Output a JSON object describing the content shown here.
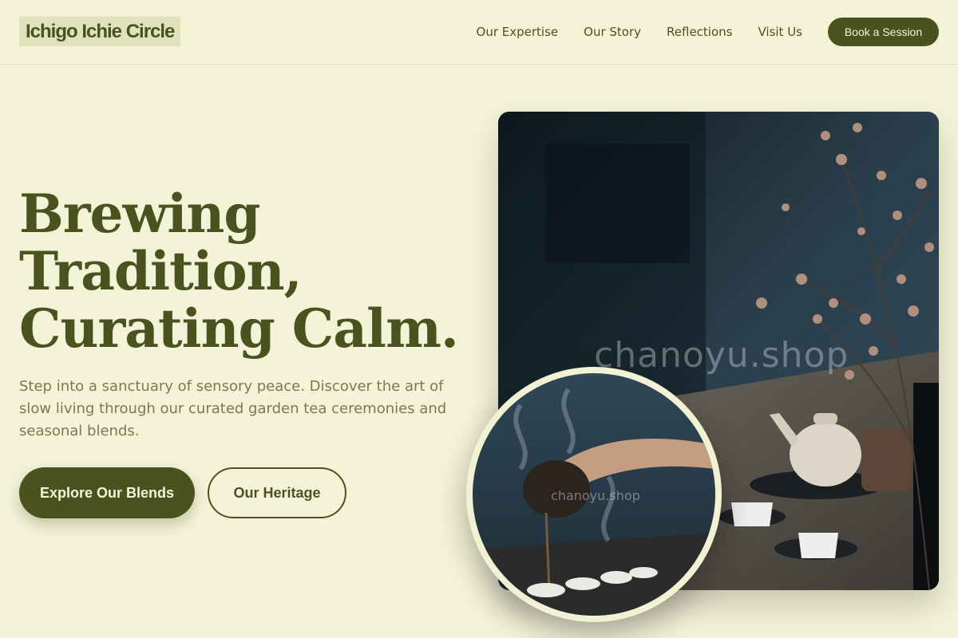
{
  "brand": {
    "name": "Ichigo Ichie Circle"
  },
  "nav": {
    "links": [
      "Our Expertise",
      "Our Story",
      "Reflections",
      "Visit Us"
    ],
    "cta_label": "Book a Session"
  },
  "hero": {
    "title_lines": [
      "Brewing",
      "Tradition,",
      "Curating Calm."
    ],
    "subtitle": "Step into a sanctuary of sensory peace. Discover the art of slow living through our curated garden tea ceremonies and seasonal blends.",
    "primary_button": "Explore Our Blends",
    "secondary_button": "Our Heritage"
  },
  "images": {
    "main_watermark": "chanoyu.shop",
    "circle_watermark": "chanoyu.shop"
  },
  "colors": {
    "background": "#f3f3d8",
    "accent": "#4a5320",
    "muted_text": "#787a55"
  }
}
